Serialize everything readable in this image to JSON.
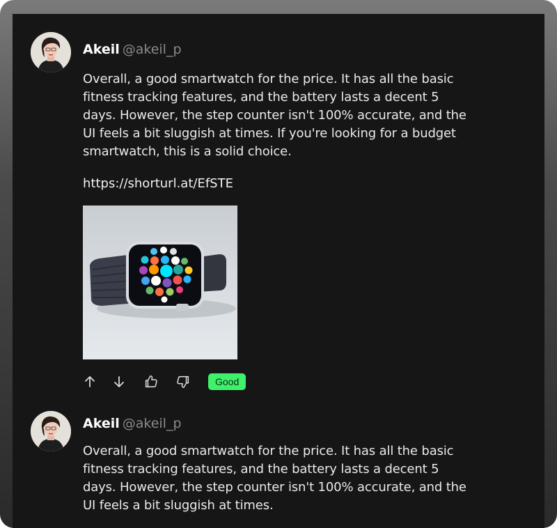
{
  "posts": [
    {
      "author_name": "Akeil",
      "author_handle": "@akeil_p",
      "text": "Overall, a good smartwatch for the price. It has all the basic fitness tracking features, and the battery lasts a decent 5 days. However, the step counter isn't 100% accurate, and the UI feels a bit sluggish at times. If you're looking for a budget smartwatch, this is a solid choice.",
      "link": "https://shorturl.at/EfSTE",
      "rating_badge": "Good",
      "badge_color": "#3ef06a",
      "actions": [
        "arrow-up-icon",
        "arrow-down-icon",
        "thumbs-up-icon",
        "thumbs-down-icon"
      ]
    },
    {
      "author_name": "Akeil",
      "author_handle": "@akeil_p",
      "text": "Overall, a good smartwatch for the price. It has all the basic fitness tracking features, and the battery lasts a decent 5 days. However, the step counter isn't 100% accurate, and the UI feels a bit sluggish at times."
    }
  ],
  "colors": {
    "panel_background": "#161616",
    "text_primary": "#eaeaea",
    "text_secondary": "#8a8a8a"
  }
}
